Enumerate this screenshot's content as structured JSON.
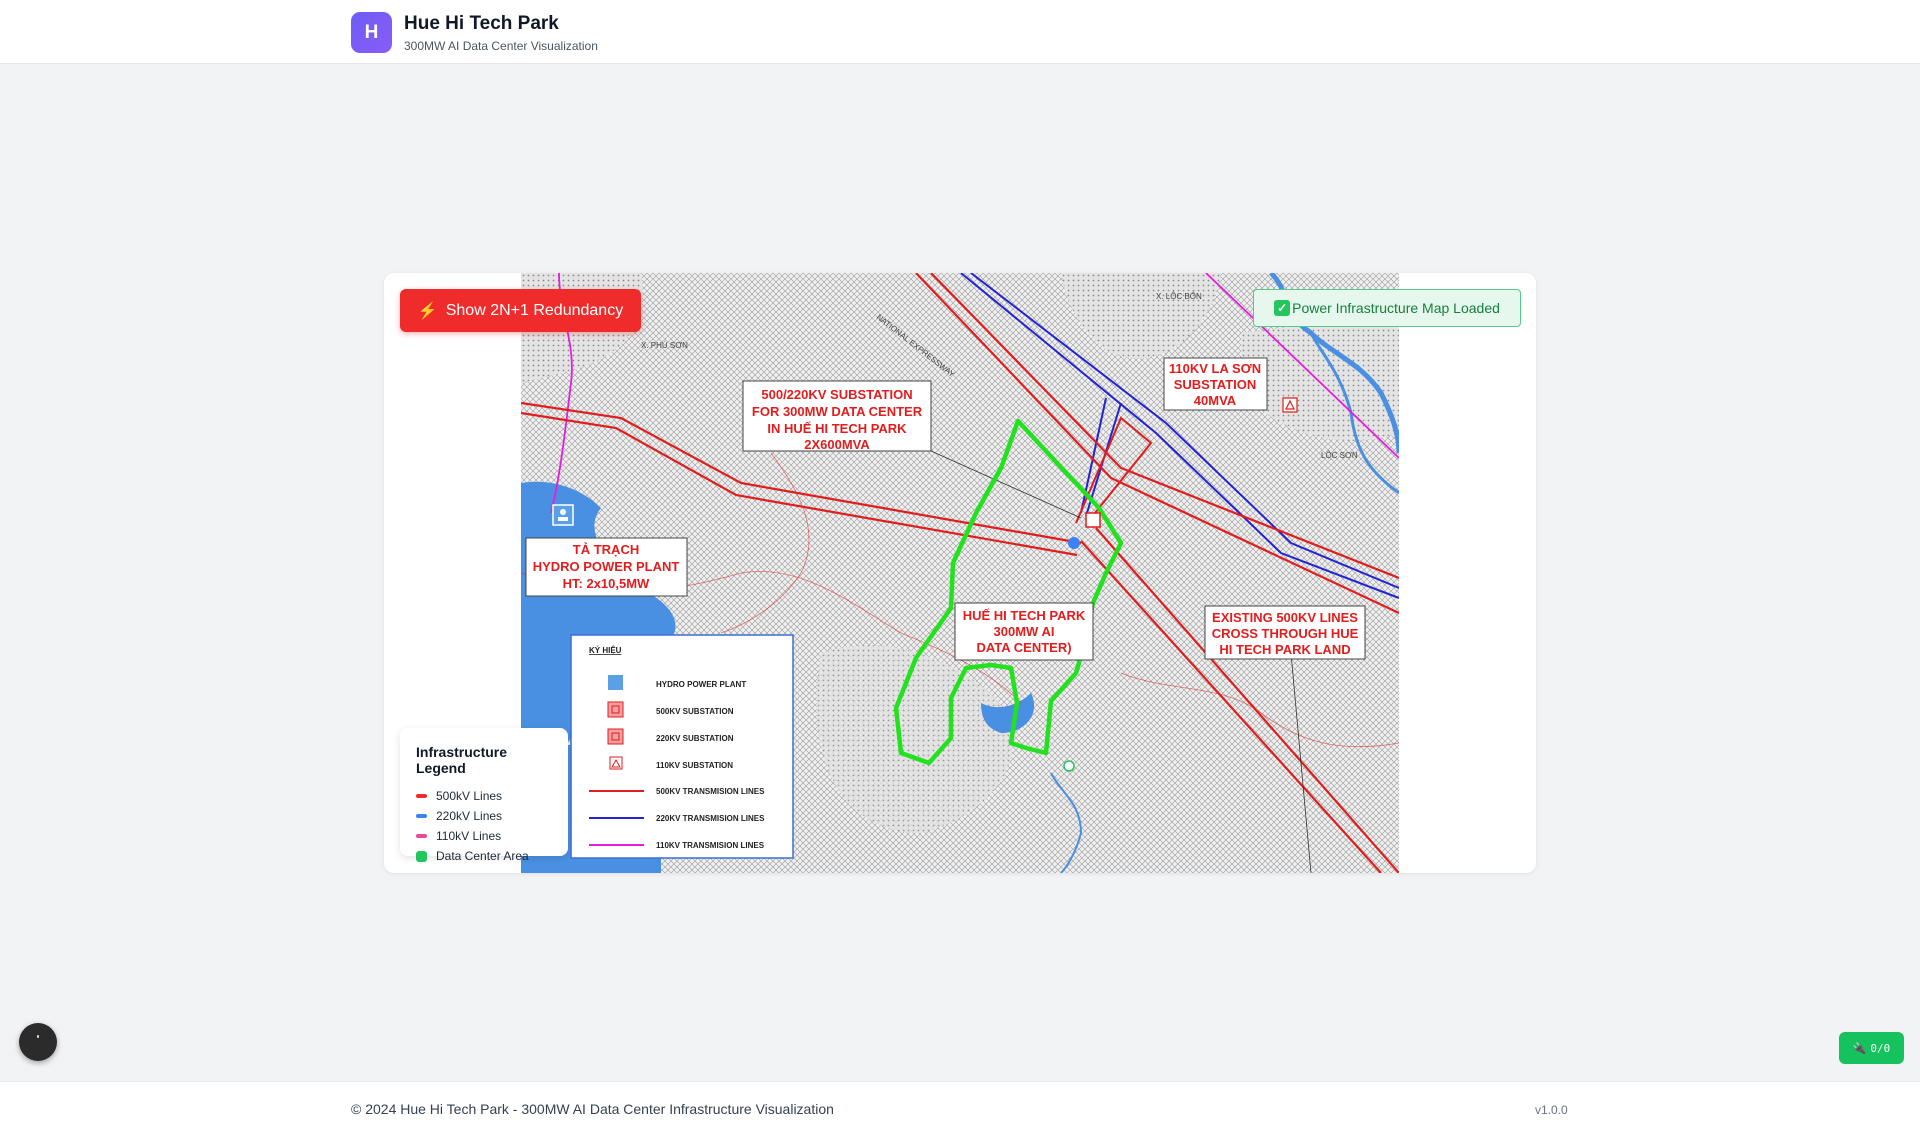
{
  "header": {
    "logo_letter": "H",
    "title": "Hue Hi Tech Park",
    "subtitle": "300MW AI Data Center Visualization"
  },
  "controls": {
    "redundancy_icon": "⚡",
    "redundancy_label": "Show 2N+1 Redundancy",
    "status_icon": "✓",
    "status_text": "Power Infrastructure Map Loaded"
  },
  "legend": {
    "title": "Infrastructure Legend",
    "items": [
      {
        "label": "500kV Lines",
        "color": "#ef2b2b"
      },
      {
        "label": "220kV Lines",
        "color": "#3b82f6"
      },
      {
        "label": "110kV Lines",
        "color": "#ec4899"
      },
      {
        "label": "Data Center Area",
        "color": "#22c55e"
      }
    ]
  },
  "map": {
    "labels": {
      "substation_500": [
        "500/220KV SUBSTATION",
        "FOR 300MW DATA CENTER",
        "IN HUẾ HI TECH PARK",
        "2X600MVA"
      ],
      "la_son": [
        "110KV LA SƠN",
        "SUBSTATION",
        "40MVA"
      ],
      "ta_trach": [
        "TẢ TRẠCH",
        "HYDRO POWER PLANT",
        "HT: 2x10,5MW"
      ],
      "hue_park": [
        "HUẾ HI TECH PARK",
        "300MW AI",
        "DATA CENTER)"
      ],
      "existing_lines": [
        "EXISTING 500KV LINES",
        "CROSS THROUGH HUE",
        "HI TECH PARK LAND"
      ],
      "place_phu_son": "X. PHÚ SƠN",
      "place_loc_bon": "X. LỘC BỔN",
      "place_loc_son": "LỘC SƠN",
      "expressway": "NATIONAL EXPRESSWAY"
    },
    "key": {
      "title": "KÝ HIỆU",
      "items": [
        "HYDRO POWER PLANT",
        "500KV SUBSTATION",
        "220KV SUBSTATION",
        "110KV SUBSTATION",
        "500KV TRANSMISION LINES",
        "220KV TRANSMISION LINES",
        "110KV TRANSMISION LINES"
      ]
    },
    "colors": {
      "line_500": "#e11d1d",
      "line_220": "#2323d6",
      "line_110": "#e81ce0",
      "area": "#22e21e",
      "water": "#4a90e2"
    }
  },
  "fab": {
    "icon": "help-icon"
  },
  "counter": {
    "icon": "plug-icon",
    "glyph": "🔌",
    "value": "0/0"
  },
  "footer": {
    "copyright": "© 2024 Hue Hi Tech Park - 300MW AI Data Center Infrastructure Visualization",
    "version": "v1.0.0"
  }
}
